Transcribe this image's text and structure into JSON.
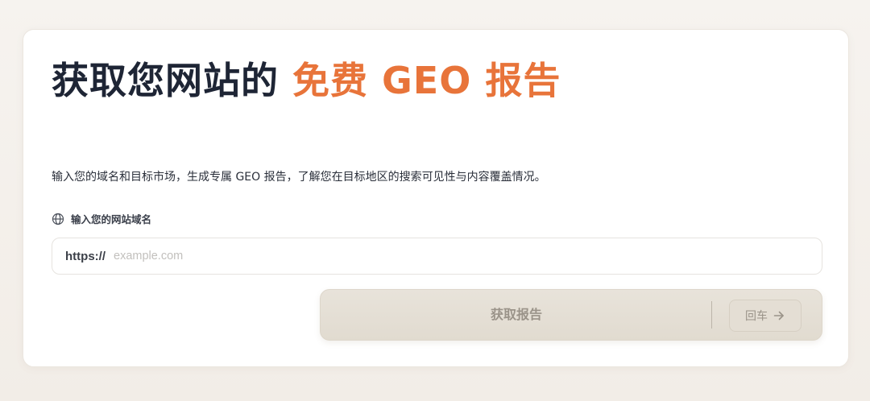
{
  "hero": {
    "title_main": "获取您网站的",
    "title_accent": "免费 GEO 报告",
    "subtitle": "输入您的域名和目标市场，生成专属 GEO 报告，了解您在目标地区的搜索可见性与内容覆盖情况。"
  },
  "form": {
    "field_label": "输入您的网站域名",
    "field_icon": "globe-icon",
    "url_prefix": "https://",
    "url_value": "",
    "url_placeholder": "example.com",
    "submit_label": "获取报告",
    "enter_hint": "回车",
    "enter_icon": "arrow-right-icon"
  },
  "colors": {
    "accent": "#e8743a",
    "title": "#1e2535",
    "button_bg": "#e5dfd5",
    "button_text": "#9a9389"
  }
}
